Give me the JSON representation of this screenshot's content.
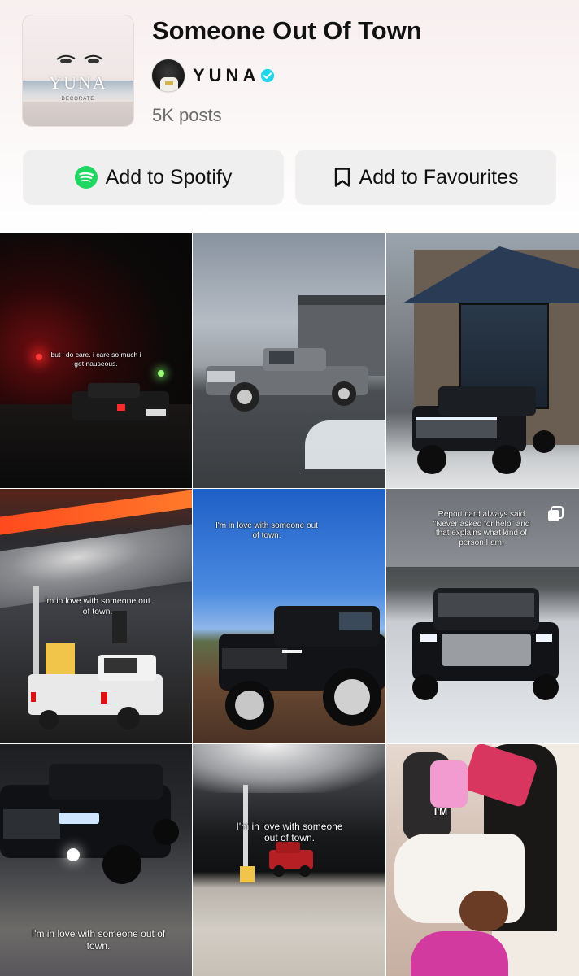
{
  "playlist": {
    "title": "Someone Out Of Town",
    "creator_name": "YUNA",
    "posts": "5K posts",
    "cover_logo": "YUNA",
    "cover_sublogo": "DECORATE"
  },
  "actions": {
    "spotify_label": "Add to Spotify",
    "favourites_label": "Add to Favourites"
  },
  "colors": {
    "spotify_green": "#1ed760",
    "verified_blue": "#20d5ec",
    "button_bg": "#efefef"
  },
  "icons": {
    "spotify": "spotify-icon",
    "bookmark": "bookmark-icon",
    "verified": "verified-badge-icon",
    "multi": "multi-image-icon"
  },
  "grid": {
    "tiles": [
      {
        "caption": "but i do care. i care so much i get nauseous."
      },
      {
        "caption": ""
      },
      {
        "caption": ""
      },
      {
        "caption": "im in love with someone out of town."
      },
      {
        "caption": "I'm in love with someone out of town."
      },
      {
        "caption": "Report card always said \"Never asked for help\" and that explains what kind of person I am."
      },
      {
        "caption": "I'm in love with someone out of town."
      },
      {
        "caption": "I'm in love with someone out of town."
      },
      {
        "caption": "I'M"
      }
    ]
  }
}
